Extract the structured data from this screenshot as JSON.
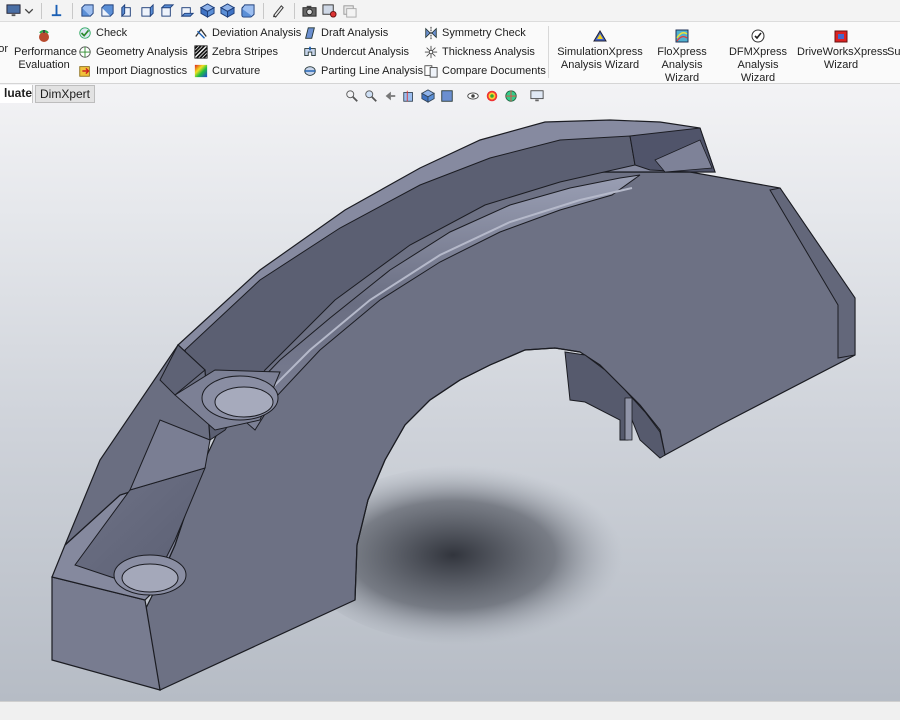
{
  "ribbon": {
    "left_clip": "or",
    "performance": {
      "line1": "Performance",
      "line2": "Evaluation"
    },
    "col1": [
      {
        "label": "Check",
        "icon": "check-icon"
      },
      {
        "label": "Geometry Analysis",
        "icon": "geometry-analysis-icon"
      },
      {
        "label": "Import Diagnostics",
        "icon": "import-diagnostics-icon"
      }
    ],
    "col2": [
      {
        "label": "Deviation Analysis",
        "icon": "deviation-analysis-icon"
      },
      {
        "label": "Zebra Stripes",
        "icon": "zebra-stripes-icon"
      },
      {
        "label": "Curvature",
        "icon": "curvature-icon"
      }
    ],
    "col3": [
      {
        "label": "Draft Analysis",
        "icon": "draft-analysis-icon"
      },
      {
        "label": "Undercut Analysis",
        "icon": "undercut-analysis-icon"
      },
      {
        "label": "Parting Line Analysis",
        "icon": "parting-line-analysis-icon"
      }
    ],
    "col4": [
      {
        "label": "Symmetry Check",
        "icon": "symmetry-check-icon"
      },
      {
        "label": "Thickness Analysis",
        "icon": "thickness-analysis-icon"
      },
      {
        "label": "Compare Documents",
        "icon": "compare-documents-icon"
      }
    ],
    "wizards": [
      {
        "line1": "SimulationXpress",
        "line2": "Analysis Wizard",
        "icon": "simulationxpress-icon"
      },
      {
        "line1": "FloXpress",
        "line2": "Analysis Wizard",
        "icon": "floxpress-icon"
      },
      {
        "line1": "DFMXpress",
        "line2": "Analysis Wizard",
        "icon": "dfmxpress-icon"
      },
      {
        "line1": "DriveWorksXpress",
        "line2": "Wizard",
        "icon": "driveworksxpress-icon"
      }
    ],
    "right_clip": "Su"
  },
  "tabs": {
    "active": "luate",
    "dimxpert": "DimXpert"
  },
  "colors": {
    "model_face": "#6c7083",
    "model_top": "#8a8fa4",
    "model_edge": "#1b1c22",
    "accent": "#1a5fb4"
  }
}
